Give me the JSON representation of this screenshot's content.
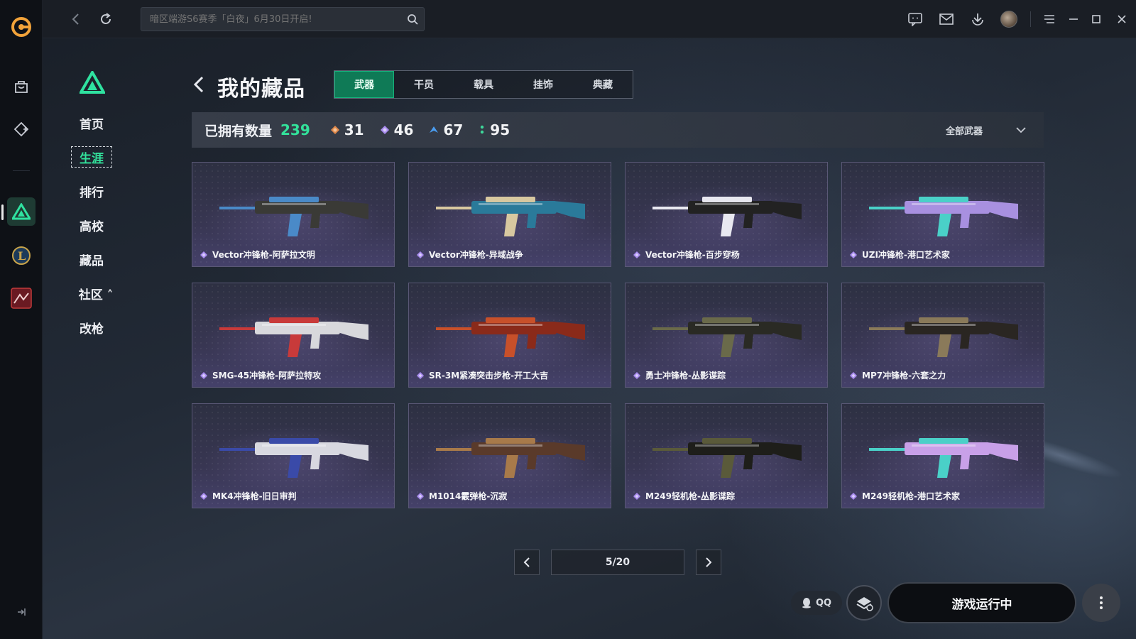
{
  "topbar": {
    "search_placeholder": "暗区端游S6赛季「白夜」6月30日开启!"
  },
  "game_nav": {
    "items": [
      {
        "label": "首页"
      },
      {
        "label": "生涯"
      },
      {
        "label": "排行"
      },
      {
        "label": "高校"
      },
      {
        "label": "藏品"
      },
      {
        "label": "社区 ˄"
      },
      {
        "label": "改枪"
      }
    ],
    "active_index": 1
  },
  "page": {
    "title": "我的藏品",
    "tabs": [
      {
        "label": "武器"
      },
      {
        "label": "干员"
      },
      {
        "label": "载具"
      },
      {
        "label": "挂饰"
      },
      {
        "label": "典藏"
      }
    ],
    "active_tab": 0
  },
  "stats": {
    "label": "已拥有数量",
    "total": "239",
    "rarities": [
      {
        "count": "31",
        "color": "#e0884a",
        "icon": "orange-diamond-icon"
      },
      {
        "count": "46",
        "color": "#a98cf0",
        "icon": "purple-diamond-icon"
      },
      {
        "count": "67",
        "color": "#4a9cf0",
        "icon": "blue-chevron-icon"
      },
      {
        "count": "95",
        "color": "#3ed69a",
        "icon": "green-dots-icon"
      }
    ],
    "filter_label": "全部武器"
  },
  "items": [
    {
      "name": "Vector冲锋枪-阿萨拉文明",
      "tint": "#4a8ac8",
      "body": "#3a3a36"
    },
    {
      "name": "Vector冲锋枪-异域战争",
      "tint": "#d8c8a0",
      "body": "#2a7a9a"
    },
    {
      "name": "Vector冲锋枪-百步穿杨",
      "tint": "#e8e8f0",
      "body": "#222222"
    },
    {
      "name": "UZI冲锋枪-港口艺术家",
      "tint": "#4ad0c8",
      "body": "#a890e0"
    },
    {
      "name": "SMG-45冲锋枪-阿萨拉特攻",
      "tint": "#c83a3a",
      "body": "#d8d8dc"
    },
    {
      "name": "SR-3M紧凑突击步枪-开工大吉",
      "tint": "#c8502a",
      "body": "#8a2a1a"
    },
    {
      "name": "勇士冲锋枪-丛影谍踪",
      "tint": "#6a6a4a",
      "body": "#2a2a24"
    },
    {
      "name": "MP7冲锋枪-六套之力",
      "tint": "#8a7a5a",
      "body": "#2a2622"
    },
    {
      "name": "MK4冲锋枪-旧日审判",
      "tint": "#3a4aa8",
      "body": "#d8d8e0"
    },
    {
      "name": "M1014霰弹枪-沉寂",
      "tint": "#a87a4a",
      "body": "#5a3a2a"
    },
    {
      "name": "M249轻机枪-丛影谍踪",
      "tint": "#5a5a3a",
      "body": "#1e1e1a"
    },
    {
      "name": "M249轻机枪-港口艺术家",
      "tint": "#4ad0c8",
      "body": "#c8a0e8"
    }
  ],
  "pagination": {
    "display": "5/20"
  },
  "bottom": {
    "qq_label": "QQ",
    "play_label": "游戏运行中"
  }
}
